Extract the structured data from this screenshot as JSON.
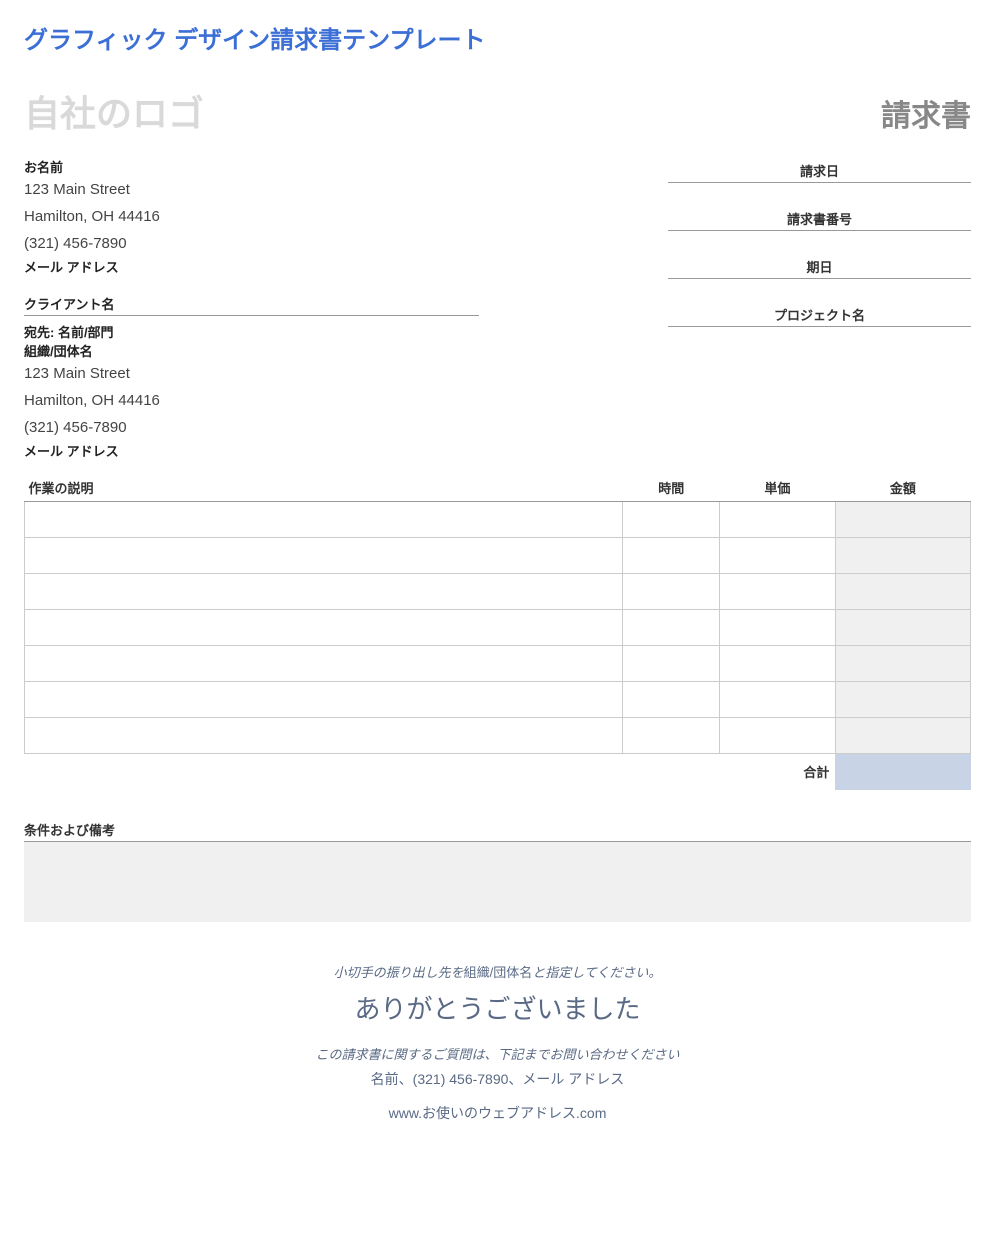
{
  "page_title": "グラフィック デザイン請求書テンプレート",
  "logo_placeholder": "自社のロゴ",
  "invoice_title": "請求書",
  "from": {
    "name_label": "お名前",
    "address1": "123 Main Street",
    "address2": "Hamilton, OH 44416",
    "phone": "(321) 456-7890",
    "email_label": "メール アドレス"
  },
  "meta": {
    "date_label": "請求日",
    "number_label": "請求書番号",
    "due_label": "期日",
    "project_label": "プロジェクト名"
  },
  "client": {
    "header": "クライアント名",
    "attn": "宛先: 名前/部門",
    "org": "組織/団体名",
    "address1": "123 Main Street",
    "address2": "Hamilton, OH 44416",
    "phone": "(321) 456-7890",
    "email_label": "メール アドレス"
  },
  "table": {
    "desc_header": "作業の説明",
    "hours_header": "時間",
    "rate_header": "単価",
    "amount_header": "金額",
    "total_label": "合計"
  },
  "notes_header": "条件および備考",
  "footer": {
    "check_prefix": "小切手の振り出し先を",
    "check_org": "組織/団体名",
    "check_suffix": "と指定してください。",
    "thanks": "ありがとうございました",
    "contact_line": "この請求書に関するご質問は、下記までお問い合わせください",
    "contact_details": "名前、(321) 456-7890、メール アドレス",
    "website": "www.お使いのウェブアドレス.com"
  }
}
